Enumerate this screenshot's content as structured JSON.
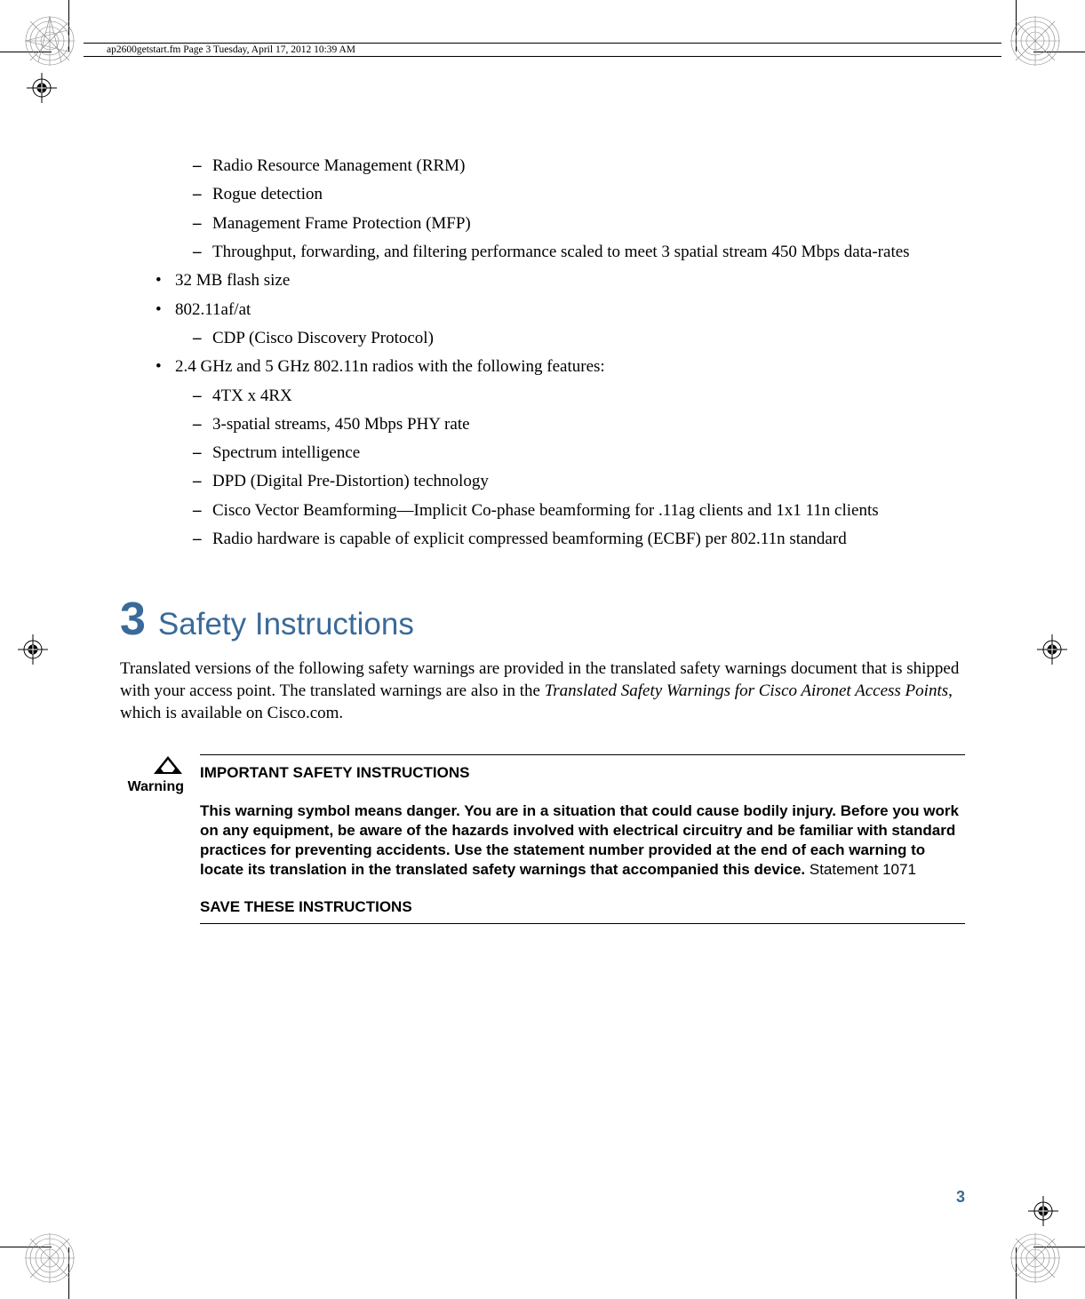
{
  "header": "ap2600getstart.fm  Page 3  Tuesday, April 17, 2012  10:39 AM",
  "bullets": {
    "top_sub": [
      "Radio Resource Management (RRM)",
      "Rogue detection",
      "Management Frame Protection (MFP)",
      "Throughput, forwarding, and filtering performance scaled to meet 3 spatial stream 450 Mbps data-rates"
    ],
    "b1": "32 MB flash size",
    "b2": "802.11af/at",
    "b2_sub": [
      "CDP (Cisco Discovery Protocol)"
    ],
    "b3": "2.4 GHz and 5 GHz 802.11n radios with the following features:",
    "b3_sub": [
      "4TX x 4RX",
      "3-spatial streams, 450 Mbps PHY rate",
      "Spectrum intelligence",
      "DPD (Digital Pre-Distortion) technology",
      "Cisco Vector Beamforming—Implicit Co-phase beamforming for .11ag clients and 1x1 11n clients",
      "Radio hardware is capable of explicit compressed beamforming (ECBF) per 802.11n standard"
    ]
  },
  "section": {
    "num": "3",
    "title": "Safety Instructions",
    "body_a": "Translated versions of the following safety warnings are provided in the translated safety warnings document that is shipped with your access point. The translated warnings are also in the ",
    "body_italic": "Translated Safety Warnings for Cisco Aironet Access Points",
    "body_b": ", which is available on Cisco.com."
  },
  "warning": {
    "label": "Warning",
    "title": "IMPORTANT SAFETY INSTRUCTIONS",
    "body_bold": "This warning symbol means danger. You are in a situation that could cause bodily injury. Before you work on any equipment, be aware of the hazards involved with electrical circuitry and be familiar with standard practices for preventing accidents. Use the statement number provided at the end of each warning to locate its translation in the translated safety warnings that accompanied this device.",
    "body_plain": " Statement 1071",
    "save": "SAVE THESE INSTRUCTIONS"
  },
  "page_number": "3"
}
